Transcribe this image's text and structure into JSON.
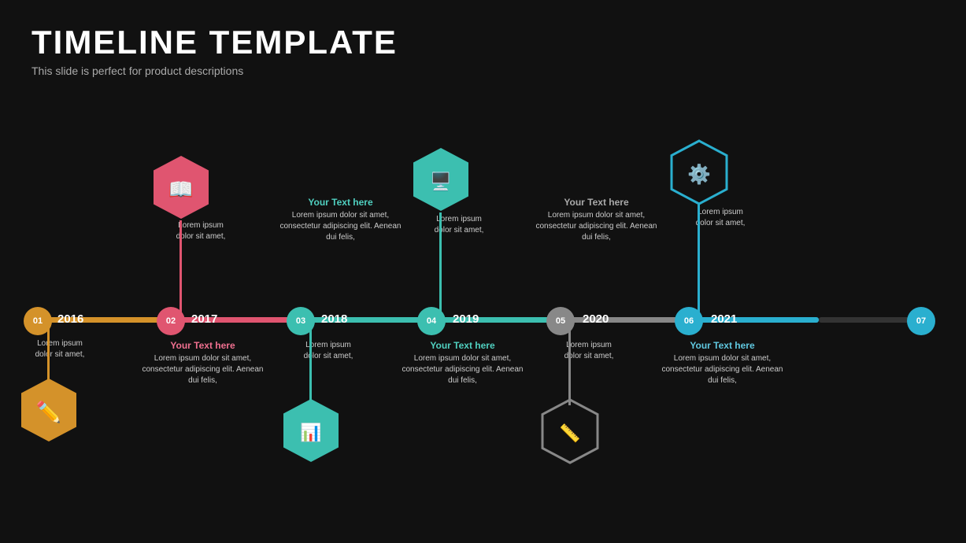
{
  "header": {
    "title": "TIMELINE TEMPLATE",
    "subtitle": "This slide is perfect for product descriptions"
  },
  "nodes": [
    {
      "id": "n1",
      "number": "01",
      "year": "2016",
      "color": "orange",
      "hex_filled": true,
      "hex_position": "below",
      "icon": "✏",
      "title_above": null,
      "body_above": null,
      "title_below": null,
      "body_below": "Lorem ipsum dolor sit amet,"
    },
    {
      "id": "n2",
      "number": "02",
      "year": "2017",
      "color": "red",
      "hex_filled": true,
      "hex_position": "above",
      "icon": "📖",
      "title_above": null,
      "body_above": "Lorem ipsum dolor sit amet,",
      "title_below": "Your Text here",
      "body_below": "Lorem ipsum dolor sit amet, consectetur adipiscing elit. Aenean dui felis,"
    },
    {
      "id": "n3",
      "number": "03",
      "year": "2018",
      "color": "teal",
      "hex_filled": true,
      "hex_position": "below",
      "icon": "📊",
      "title_above": "Your Text here",
      "body_above": "Lorem ipsum dolor sit amet, consectetur adipiscing elit. Aenean dui felis,",
      "title_below": null,
      "body_below": "Lorem ipsum dolor sit amet,"
    },
    {
      "id": "n4",
      "number": "04",
      "year": "2019",
      "color": "teal",
      "hex_filled": true,
      "hex_position": "above",
      "icon": "🖥",
      "title_above": null,
      "body_above": "Lorem ipsum dolor sit amet,",
      "title_below": "Your Text here",
      "body_below": "Lorem ipsum dolor sit amet, consectetur adipiscing elit. Aenean dui felis,"
    },
    {
      "id": "n5",
      "number": "05",
      "year": "2020",
      "color": "gray",
      "hex_filled": false,
      "hex_position": "below",
      "icon": "📏",
      "title_above": "Your Text here",
      "body_above": "Lorem ipsum dolor sit amet, consectetur adipiscing elit. Aenean dui felis,",
      "title_below": null,
      "body_below": "Lorem ipsum dolor sit amet,"
    },
    {
      "id": "n6",
      "number": "06",
      "year": "2021",
      "color": "blue",
      "hex_filled": true,
      "hex_position": "above",
      "icon": "⚙",
      "title_above": null,
      "body_above": "Lorem ipsum dolor sit amet,",
      "title_below": "Your Text here",
      "body_below": "Lorem ipsum dolor sit amet, consectetur adipiscing elit. Aenean dui felis,"
    },
    {
      "id": "n7",
      "number": "07",
      "year": "",
      "color": "blue",
      "hex_filled": false,
      "hex_position": null,
      "icon": null,
      "title_above": null,
      "body_above": null,
      "title_below": null,
      "body_below": null
    }
  ],
  "colors": {
    "orange": "#D4922A",
    "red": "#E05570",
    "teal": "#3CBFB0",
    "gray": "#888888",
    "blue": "#2AAFCF",
    "orange_title": "#D4B060",
    "red_title": "#F07090",
    "teal_title": "#50D0C0",
    "blue_title": "#60C8E0"
  }
}
